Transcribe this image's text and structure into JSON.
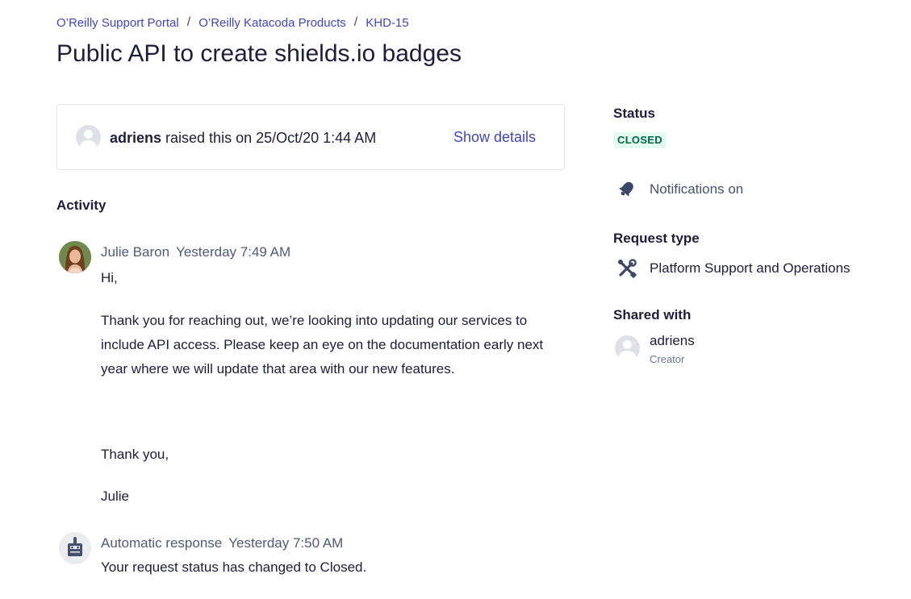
{
  "breadcrumb": {
    "items": [
      "O’Reilly Support Portal",
      "O’Reilly Katacoda Products",
      "KHD-15"
    ],
    "separator": "/"
  },
  "page_title": "Public API to create shields.io badges",
  "request": {
    "reporter": "adriens",
    "raised_text": " raised this on 25/Oct/20 1:44 AM",
    "show_details": "Show details"
  },
  "activity": {
    "heading": "Activity",
    "comments": [
      {
        "author": "Julie Baron",
        "time": "Yesterday 7:49 AM",
        "lines": [
          "Hi,",
          "Thank you for reaching out, we’re looking into updating our services to",
          "include API access.  Please keep an eye on the documentation early next",
          "year where we will update that area with our new features.",
          "Thank you,",
          "Julie"
        ]
      },
      {
        "author": "Automatic response",
        "time": "Yesterday 7:50 AM",
        "lines": [
          "Your request status has changed to Closed."
        ]
      }
    ]
  },
  "sidebar": {
    "status_heading": "Status",
    "status_value": "CLOSED",
    "notifications": "Notifications on",
    "request_type_heading": "Request type",
    "request_type": "Platform Support and Operations",
    "shared_heading": "Shared with",
    "shared_user": "adriens",
    "shared_role": "Creator"
  },
  "colors": {
    "link": "#3f44c6",
    "text": "#1d1d3c",
    "status_bg": "#e3fcef",
    "status_text": "#006644"
  },
  "icons": [
    "default-avatar-icon",
    "bell-icon",
    "tools-icon",
    "robot-icon"
  ]
}
